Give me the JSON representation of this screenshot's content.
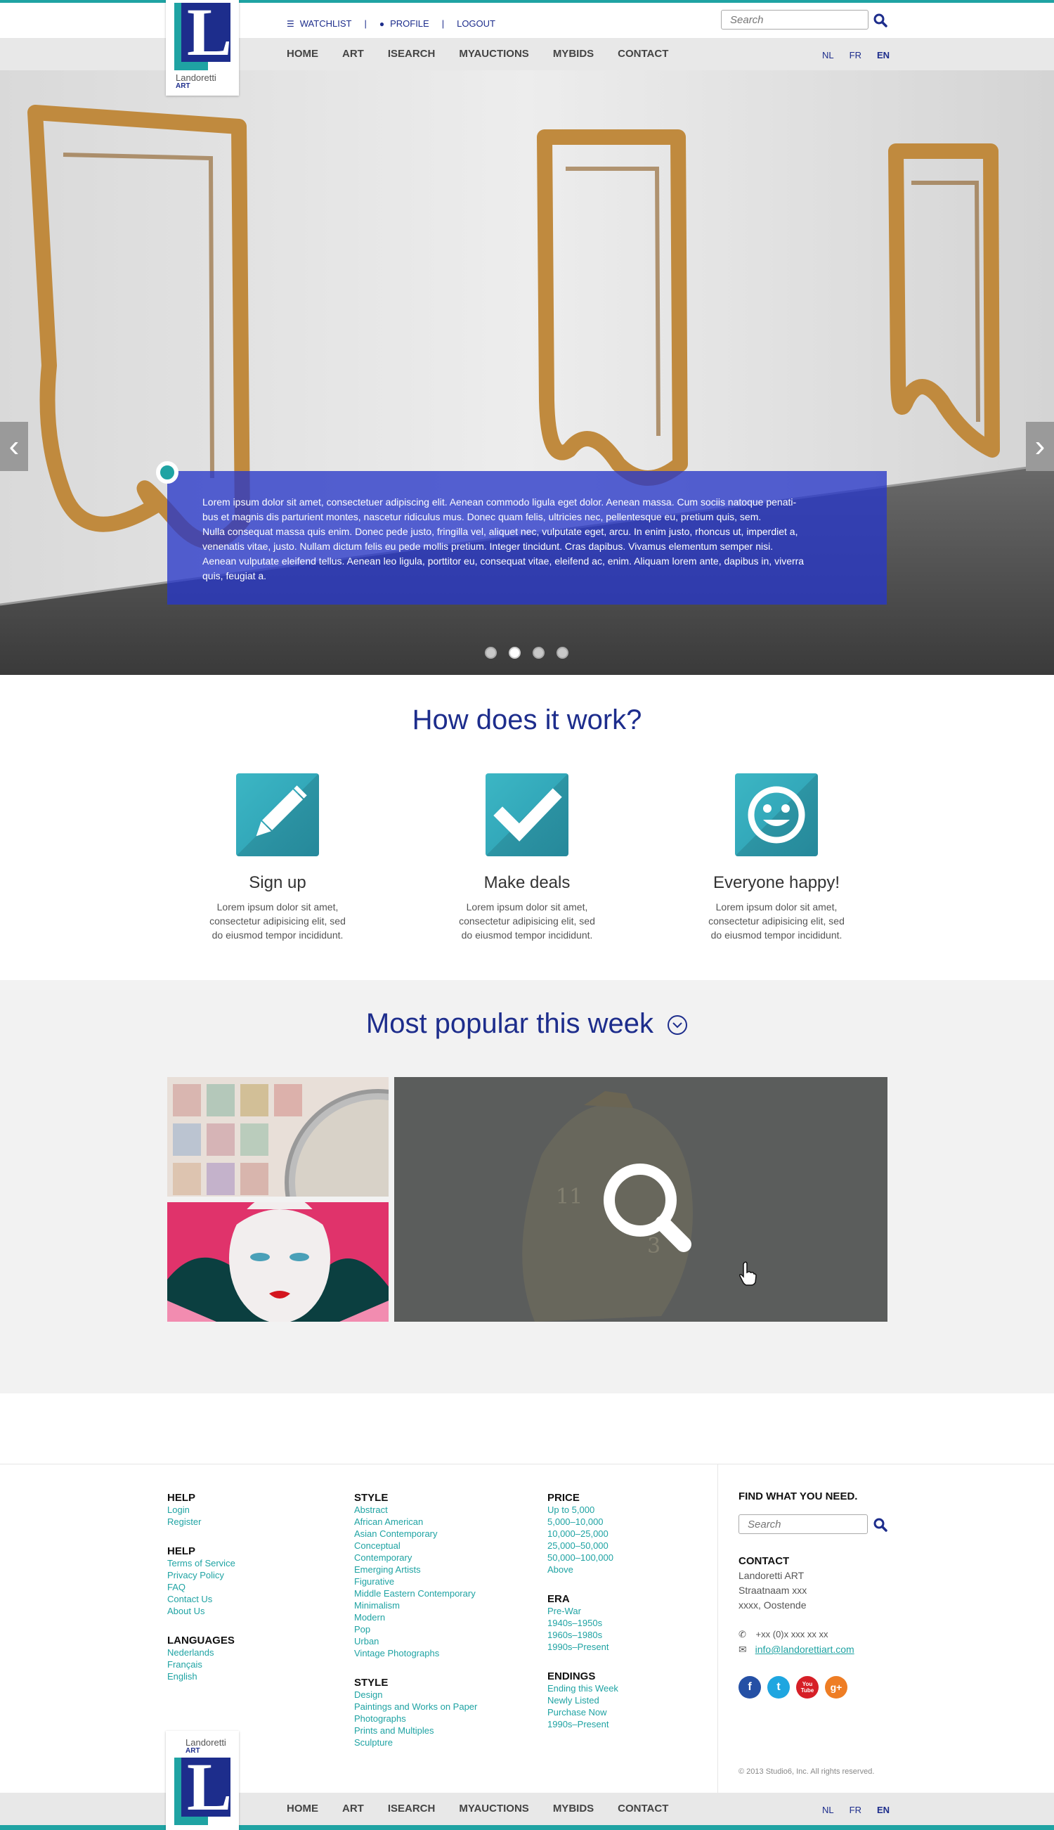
{
  "header": {
    "logo_name": "Landoretti",
    "logo_sub": "ART",
    "watchlist": "WATCHLIST",
    "profile": "PROFILE",
    "logout": "LOGOUT",
    "separator": "|",
    "search_placeholder": "Search"
  },
  "nav": {
    "items": [
      "HOME",
      "ART",
      "ISEARCH",
      "MYAUCTIONS",
      "MYBIDS",
      "CONTACT"
    ],
    "languages": [
      "NL",
      "FR",
      "EN"
    ],
    "active_language": "EN"
  },
  "hero": {
    "caption_lines": [
      "Lorem ipsum dolor sit amet, consectetuer adipiscing elit. Aenean commodo ligula eget dolor. Aenean massa. Cum sociis natoque penati-",
      "bus et magnis dis parturient montes, nascetur ridiculus mus. Donec quam felis, ultricies nec, pellentesque eu, pretium quis, sem.",
      "Nulla consequat massa quis enim. Donec pede justo, fringilla vel, aliquet nec, vulputate eget, arcu. In enim justo, rhoncus ut, imperdiet a,",
      "venenatis vitae, justo. Nullam dictum felis eu pede mollis pretium. Integer tincidunt. Cras dapibus. Vivamus elementum semper nisi.",
      "Aenean vulputate eleifend tellus. Aenean leo ligula, porttitor eu, consequat vitae, eleifend ac, enim. Aliquam lorem ante, dapibus in, viverra",
      "quis, feugiat a."
    ],
    "slide_count": 4,
    "active_slide": 2
  },
  "how": {
    "title": "How does it work?",
    "steps": [
      {
        "title": "Sign up",
        "icon": "pencil-icon",
        "desc_lines": [
          "Lorem ipsum dolor sit amet,",
          "consectetur adipisicing elit, sed",
          "do eiusmod tempor incididunt."
        ]
      },
      {
        "title": "Make deals",
        "icon": "checkmark-icon",
        "desc_lines": [
          "Lorem ipsum dolor sit amet,",
          "consectetur adipisicing elit, sed",
          "do eiusmod tempor incididunt."
        ]
      },
      {
        "title": "Everyone happy!",
        "icon": "smiley-icon",
        "desc_lines": [
          "Lorem ipsum dolor sit amet,",
          "consectetur adipisicing elit, sed",
          "do eiusmod tempor incididunt."
        ]
      }
    ]
  },
  "popular": {
    "title": "Most popular this week"
  },
  "footer": {
    "col1": [
      {
        "heading": "HELP",
        "links": [
          "Login",
          "Register"
        ]
      },
      {
        "heading": "HELP",
        "links": [
          "Terms of Service",
          "Privacy Policy",
          "FAQ",
          "Contact Us",
          "About Us"
        ]
      },
      {
        "heading": "LANGUAGES",
        "links": [
          "Nederlands",
          "Français",
          "English"
        ]
      }
    ],
    "col2": [
      {
        "heading": "STYLE",
        "links": [
          "Abstract",
          "African American",
          "Asian Contemporary",
          "Conceptual",
          "Contemporary",
          "Emerging Artists",
          "Figurative",
          "Middle Eastern Contemporary",
          "Minimalism",
          "Modern",
          "Pop",
          "Urban",
          "Vintage Photographs"
        ]
      },
      {
        "heading": "STYLE",
        "links": [
          "Design",
          "Paintings and Works on Paper",
          "Photographs",
          "Prints and Multiples",
          "Sculpture"
        ]
      }
    ],
    "col3": [
      {
        "heading": "PRICE",
        "links": [
          "Up to 5,000",
          "5,000–10,000",
          "10,000–25,000",
          "25,000–50,000",
          "50,000–100,000",
          "Above"
        ]
      },
      {
        "heading": "ERA",
        "links": [
          "Pre-War",
          "1940s–1950s",
          "1960s–1980s",
          "1990s–Present"
        ]
      },
      {
        "heading": "ENDINGS",
        "links": [
          "Ending this Week",
          "Newly Listed",
          "Purchase Now",
          "1990s–Present"
        ]
      }
    ],
    "find_heading": "FIND WHAT YOU NEED.",
    "search_placeholder": "Search",
    "contact_heading": "CONTACT",
    "contact_lines": [
      "Landoretti ART",
      "Straatnaam xxx",
      "xxxx, Oostende"
    ],
    "phone": "+xx (0)x xxx xx xx",
    "email": "info@landorettiart.com",
    "social": [
      "f",
      "t",
      "You Tube",
      "g+"
    ],
    "copyright": "© 2013 Studio6, Inc. All rights reserved."
  },
  "colors": {
    "teal": "#1fa3a3",
    "navy": "#1d2d8c"
  }
}
